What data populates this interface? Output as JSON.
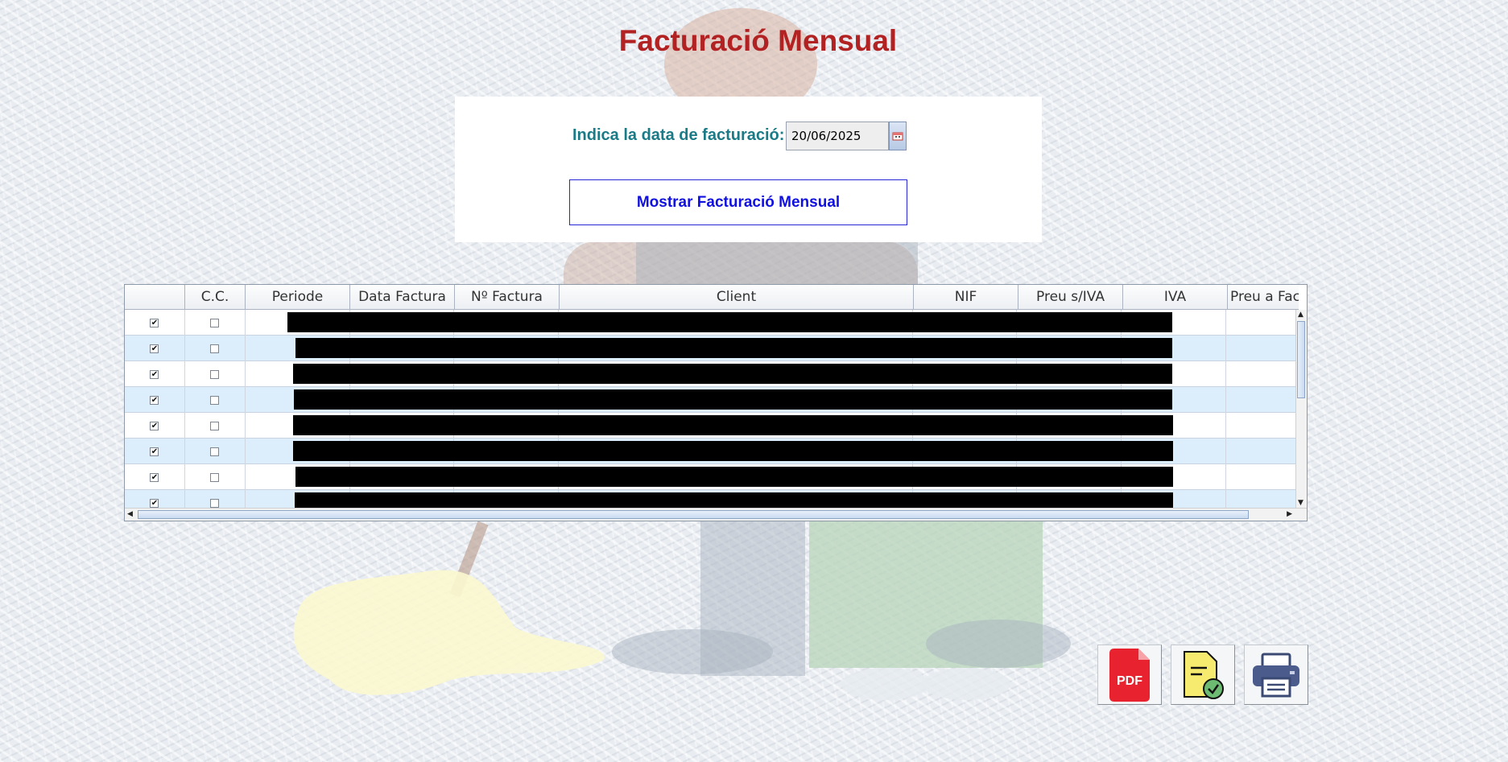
{
  "page": {
    "title": "Facturació Mensual"
  },
  "form": {
    "date_label": "Indica la data de facturació:",
    "date_value": "20/06/2025",
    "show_button_label": "Mostrar Facturació Mensual"
  },
  "table": {
    "columns": [
      "",
      "C.C.",
      "Periode",
      "Data Factura",
      "Nº Factura",
      "Client",
      "NIF",
      "Preu s/IVA",
      "IVA",
      "Preu a Fac"
    ],
    "rows": [
      {
        "selected": true,
        "cc": false,
        "redacted": true
      },
      {
        "selected": true,
        "cc": false,
        "redacted": true
      },
      {
        "selected": true,
        "cc": false,
        "redacted": true
      },
      {
        "selected": true,
        "cc": false,
        "redacted": true
      },
      {
        "selected": true,
        "cc": false,
        "redacted": true
      },
      {
        "selected": true,
        "cc": false,
        "redacted": true
      },
      {
        "selected": true,
        "cc": false,
        "redacted": true
      },
      {
        "selected": true,
        "cc": false,
        "redacted": true
      }
    ]
  },
  "actions": {
    "pdf_icon": "pdf-icon",
    "pdf_text": "PDF",
    "validate_icon": "document-check-icon",
    "print_icon": "printer-icon"
  },
  "colors": {
    "title": "#b22222",
    "label": "#1a7a86",
    "button_text": "#1010e0",
    "row_alt": "#dceefb"
  }
}
